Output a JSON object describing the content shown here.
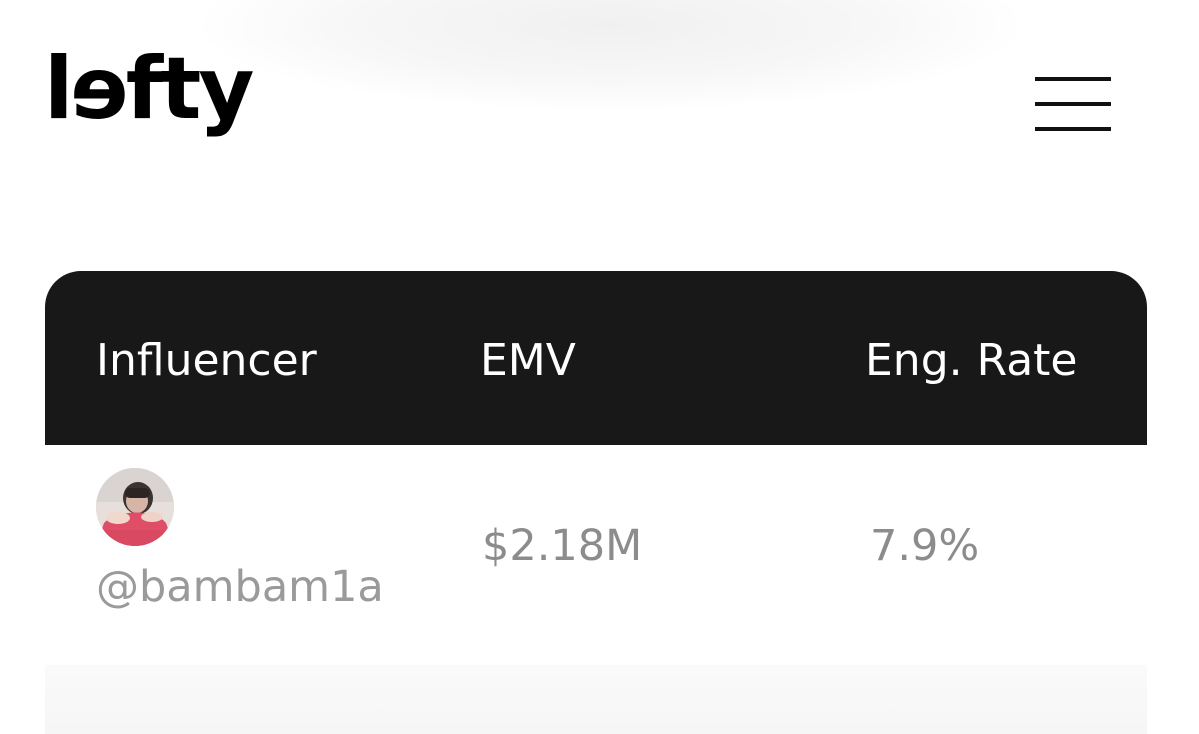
{
  "header": {
    "logo_text": "lɘfty",
    "menu_icon": "hamburger-menu-icon"
  },
  "table": {
    "columns": [
      "Influencer",
      "EMV",
      "Eng. Rate"
    ],
    "rows": [
      {
        "handle": "@bambam1a",
        "emv": "$2.18M",
        "eng_rate": "7.9%",
        "avatar_icon": "profile-photo"
      }
    ]
  },
  "colors": {
    "header_bg": "#181818",
    "header_text": "#ffffff",
    "muted_text": "#8c8c8c"
  }
}
